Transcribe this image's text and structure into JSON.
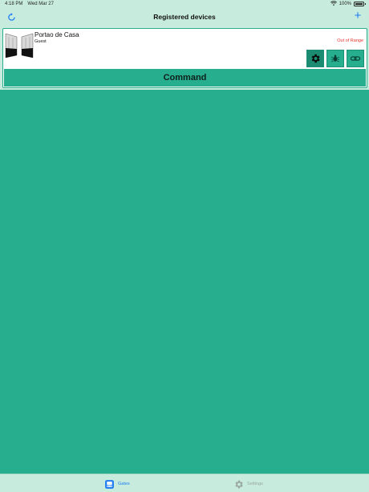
{
  "status": {
    "time": "4:18 PM",
    "date": "Wed Mar 27",
    "battery": "100%"
  },
  "nav": {
    "title": "Registered devices",
    "add_label": "+"
  },
  "device": {
    "name": "Portao de Casa",
    "role": "Guest",
    "status": "Out of Range",
    "command_label": "Command"
  },
  "tabs": [
    {
      "label": "Gates",
      "icon": "bus-icon",
      "active": true
    },
    {
      "label": "Settings",
      "icon": "gear-icon",
      "active": false
    }
  ],
  "colors": {
    "background": "#26ae8f",
    "bar": "#c7ecdd",
    "accent_blue": "#1e7cf2",
    "status_red": "#e3362d"
  }
}
